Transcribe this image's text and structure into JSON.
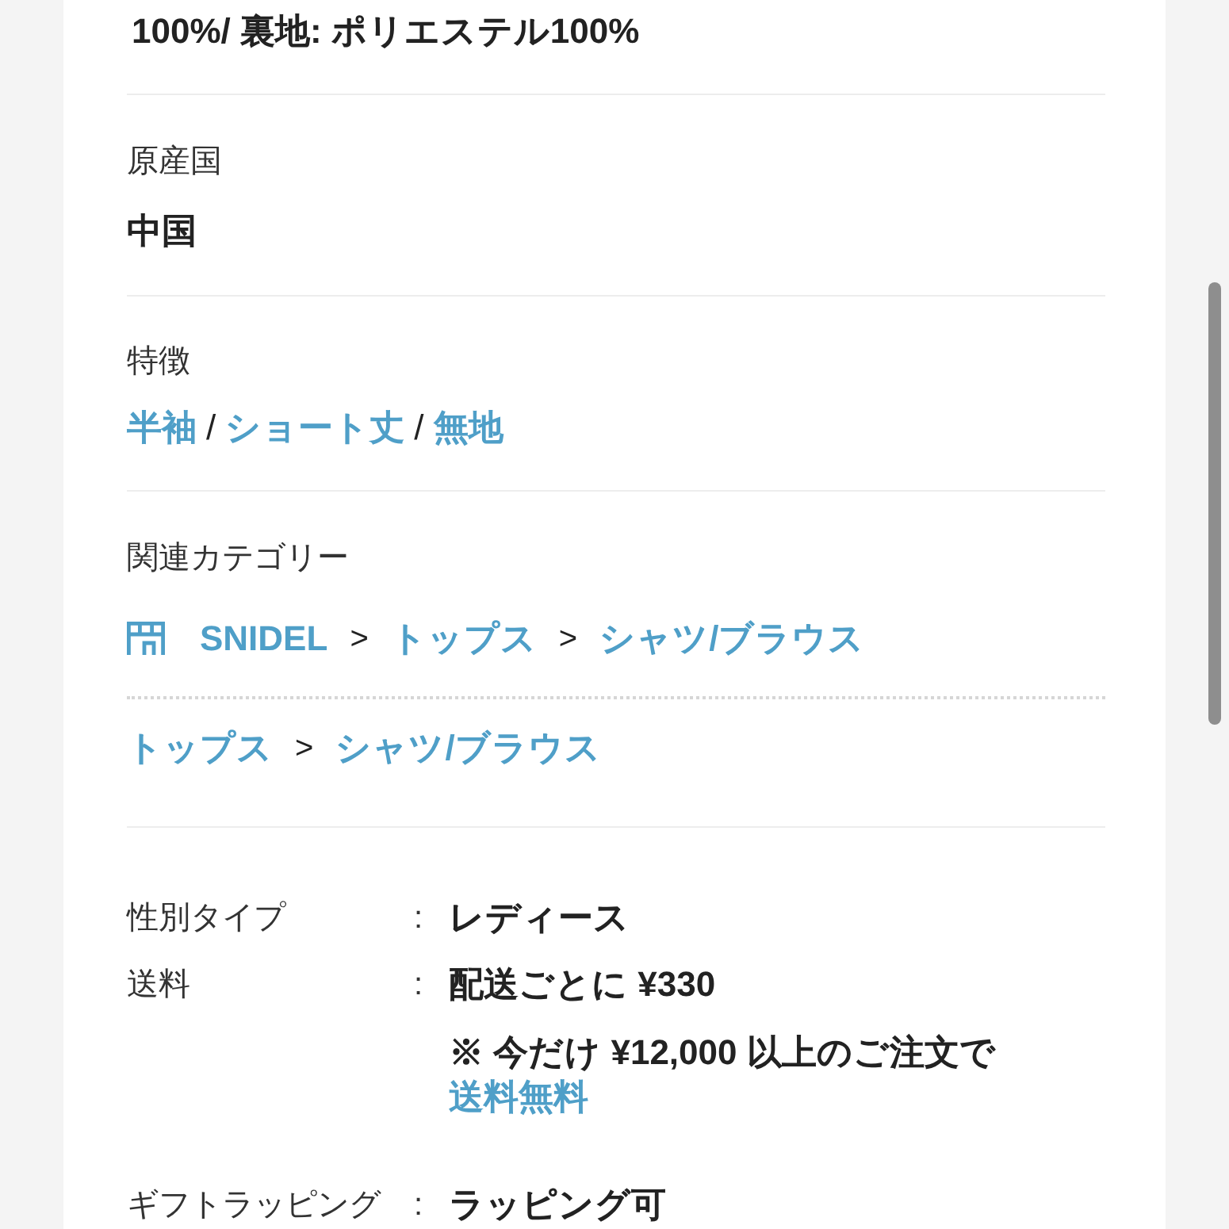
{
  "continued_value": "100%/ 裏地: ポリエステル100%",
  "sections": [
    {
      "kind": "text",
      "label": "原産国",
      "value": "中国"
    },
    {
      "kind": "links",
      "label": "特徴",
      "links": [
        {
          "text": "半袖"
        },
        {
          "separator": "/",
          "text": "ショート丈"
        },
        {
          "separator": "/",
          "text": "無地"
        }
      ]
    },
    {
      "kind": "categories",
      "label": "関連カテゴリー",
      "paths": [
        [
          {
            "kind": "brand",
            "text": "SNIDEL"
          },
          {
            "separator": ">",
            "text": "トップス"
          },
          {
            "separator": ">",
            "text": "シャツ/ブラウス"
          }
        ],
        [
          {
            "text": "トップス"
          },
          {
            "separator": ">",
            "text": "シャツ/ブラウス"
          }
        ]
      ]
    }
  ],
  "specs": [
    {
      "label": "性別タイプ",
      "colon": ":",
      "value": "レディース"
    },
    {
      "label": "送料",
      "colon": ":",
      "value": "配送ごとに ¥330",
      "note": {
        "text": "※ 今だけ ¥12,000 以上のご注文で",
        "link": "送料無料"
      }
    },
    {
      "label": "ギフトラッピング",
      "colon": ":",
      "value": "ラッピング可"
    }
  ]
}
